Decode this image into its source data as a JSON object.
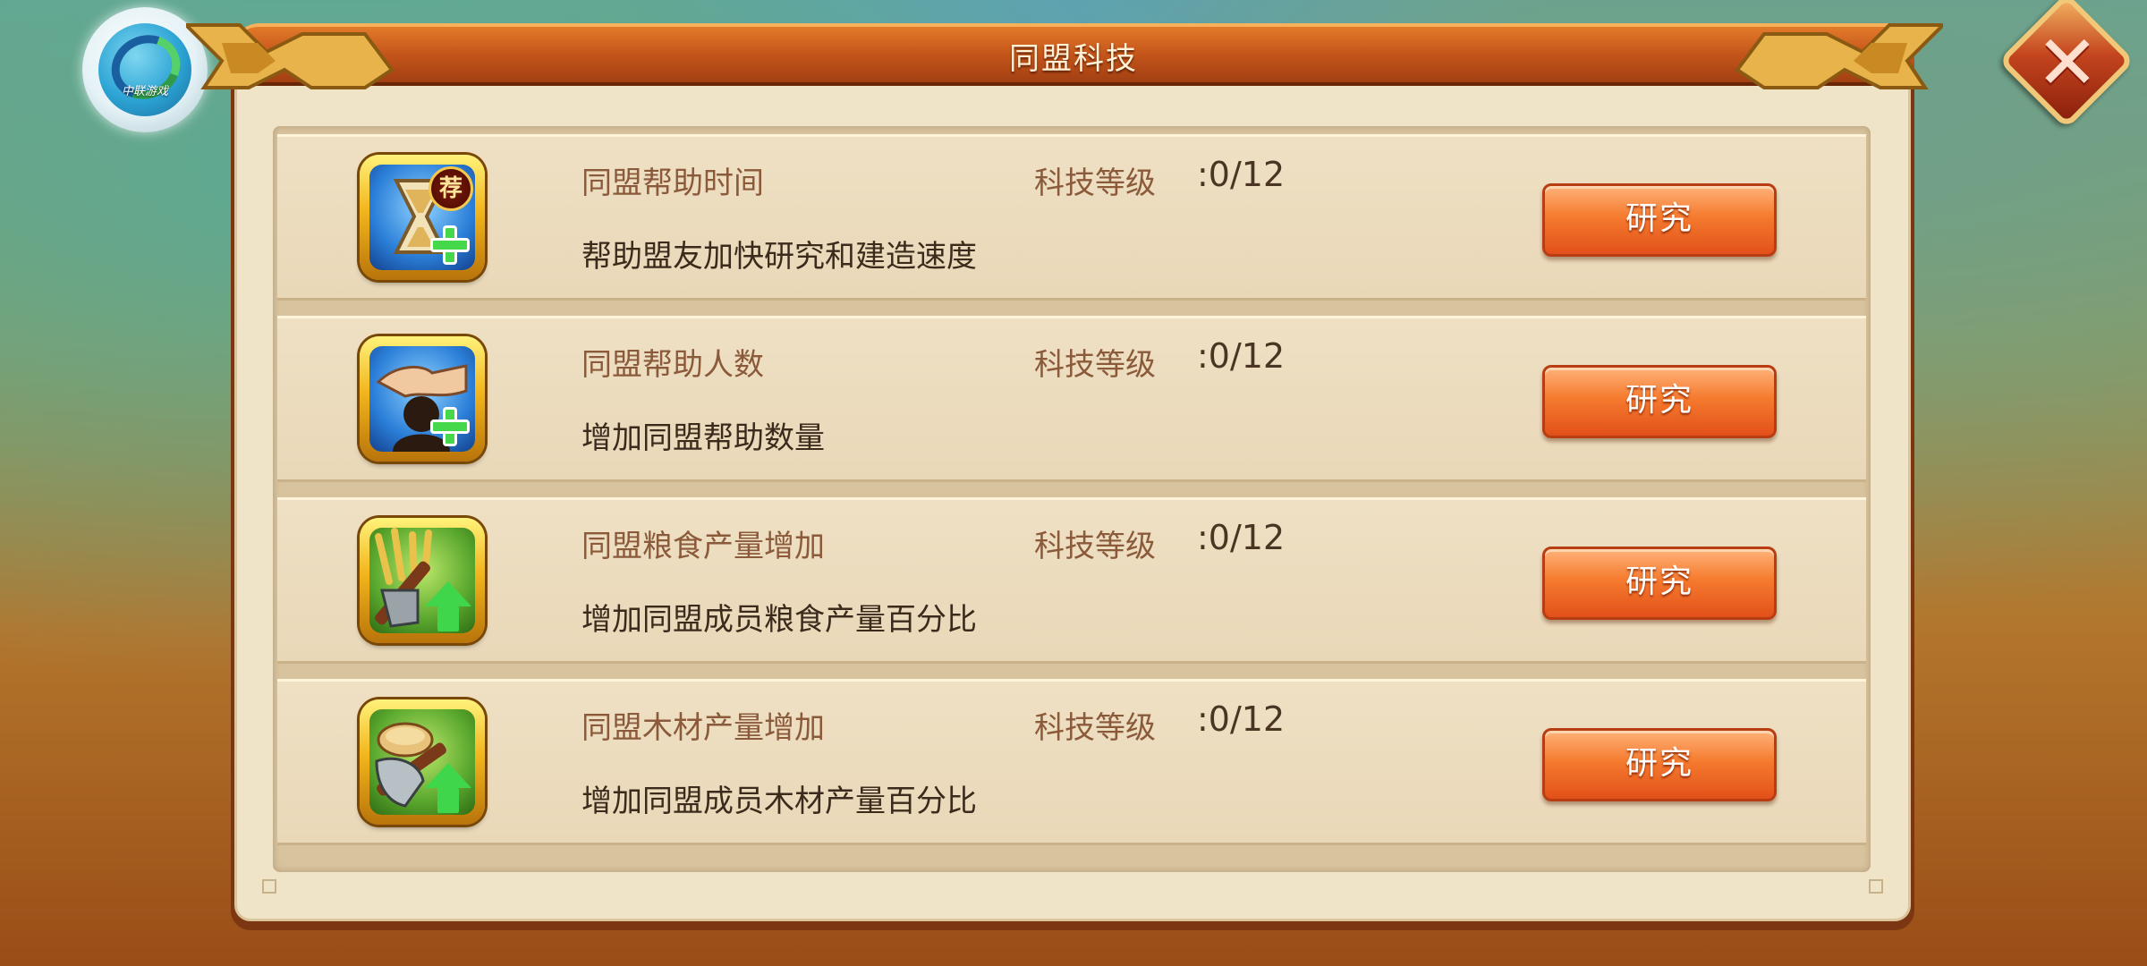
{
  "title": "同盟科技",
  "logo": {
    "text": "中联游戏",
    "icon": "zhonglian-logo-icon"
  },
  "close_icon": "close-icon",
  "close_glyph": "✕",
  "colors": {
    "title_banner": "#c4551a",
    "panel": "#f0e4c8",
    "research_button": "#f57b2e",
    "row_name_text": "#8a5a3a",
    "description_text": "#3c2a1c"
  },
  "techs": [
    {
      "icon": "hourglass-plus-icon",
      "badge": "荐",
      "name": "同盟帮助时间",
      "level_label": "科技等级",
      "level_value": ":0/12",
      "description": "帮助盟友加快研究和建造速度",
      "button_label": "研究"
    },
    {
      "icon": "handshake-plus-icon",
      "name": "同盟帮助人数",
      "level_label": "科技等级",
      "level_value": ":0/12",
      "description": "增加同盟帮助数量",
      "button_label": "研究"
    },
    {
      "icon": "wheat-hoe-up-arrow-icon",
      "name": "同盟粮食产量增加",
      "level_label": "科技等级",
      "level_value": ":0/12",
      "description": "增加同盟成员粮食产量百分比",
      "button_label": "研究"
    },
    {
      "icon": "wood-axe-up-arrow-icon",
      "name": "同盟木材产量增加",
      "level_label": "科技等级",
      "level_value": ":0/12",
      "description": "增加同盟成员木材产量百分比",
      "button_label": "研究"
    }
  ]
}
